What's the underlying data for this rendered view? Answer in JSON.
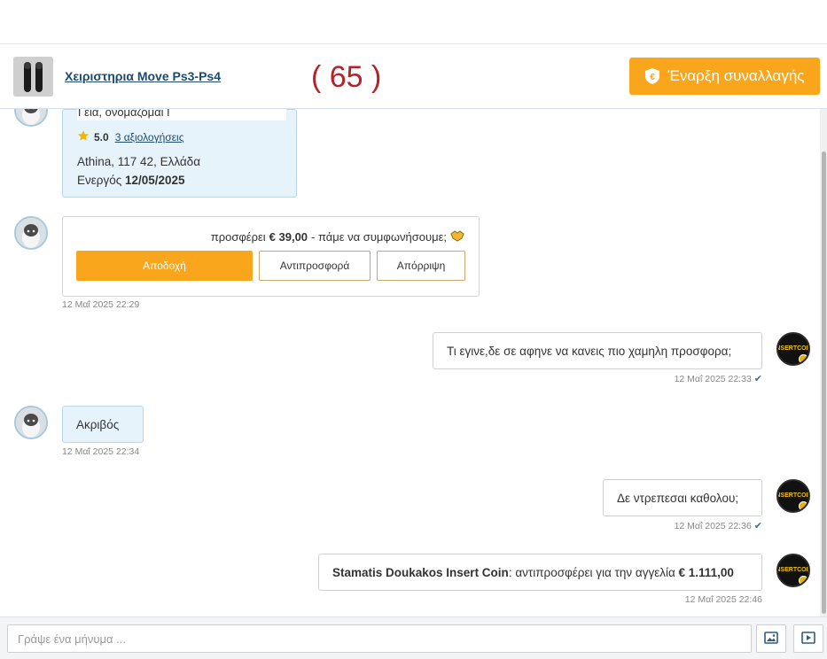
{
  "header": {
    "item_title": "Χειριστηρια Move Ps3-Ps4",
    "counter": "( 65 )",
    "start_button": "Έναρξη συναλλαγής"
  },
  "profile": {
    "greeting": "Γεια, ονομάζομαι Γ",
    "rating": "5.0",
    "reviews_link": "3 αξιολογήσεις",
    "location": "Athina, 117 42, Ελλάδα",
    "active_label": "Ενεργός",
    "active_date": "12/05/2025"
  },
  "offer": {
    "prefix": "προσφέρει",
    "amount": "€ 39,00",
    "suffix": "- πάμε να συμφωνήσουμε;",
    "accept": "Αποδοχή",
    "counter_offer": "Αντιπροσφορά",
    "reject": "Απόρριψη",
    "time": "12 Μαΐ 2025 22:29"
  },
  "messages": [
    {
      "text": "Τι εγινε,δε σε αφηνε να κανεις πιο χαμηλη προσφορα;",
      "time": "12 Μαΐ 2025 22:33"
    },
    {
      "text": "Ακριβός",
      "time": "12 Μαΐ 2025 22:34"
    },
    {
      "text": "Δε ντρεπεσαι καθολου;",
      "time": "12 Μαΐ 2025 22:36"
    },
    {
      "name": "Stamatis Doukakos Insert Coin",
      "text": ": αντιπροσφέρει για την αγγελία ",
      "amount": "€ 1.111,00",
      "time": "12 Μαΐ 2025 22:46"
    }
  ],
  "avatar_logo": {
    "line1": "INSERT",
    "line2": "COIN"
  },
  "composer": {
    "placeholder": "Γράψε ένα μήνυμα ..."
  },
  "colors": {
    "accent": "#f9a61c",
    "link": "#1d4a6e",
    "counter": "#b4232a",
    "incoming_bubble": "#e7f3fb"
  }
}
